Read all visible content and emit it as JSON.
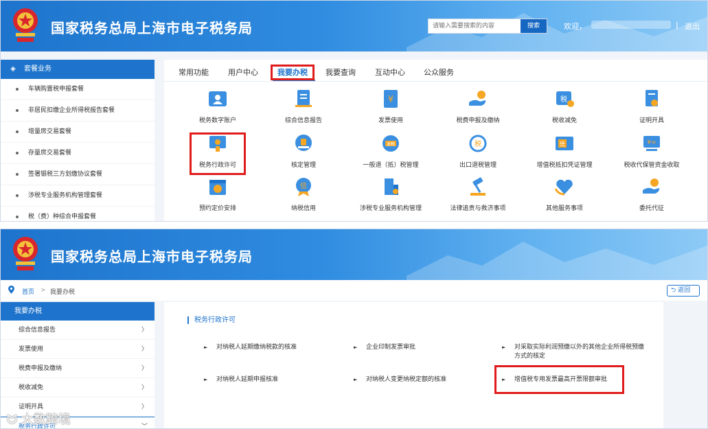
{
  "header": {
    "site_title": "国家税务总局上海市电子税务局",
    "search_placeholder": "请输入需要搜索的内容",
    "search_button": "搜索",
    "welcome": "欢迎，",
    "separator": "|",
    "logout": "退出"
  },
  "screen1": {
    "sidebar": {
      "title": "套餐业务",
      "items": [
        "车辆购置税申报套餐",
        "非居民扣缴企业所得税报告套餐",
        "增量房交易套餐",
        "存量房交易套餐",
        "签署银税三方划缴协议套餐",
        "涉税专业服务机构管理套餐",
        "税（费）种综合申报套餐"
      ]
    },
    "tabs": [
      "常用功能",
      "用户中心",
      "我要办税",
      "我要查询",
      "互动中心",
      "公众服务"
    ],
    "active_tab": "我要办税",
    "services": [
      {
        "label": "税务数字账户",
        "icon": "digital-account-icon"
      },
      {
        "label": "综合信息报告",
        "icon": "report-icon"
      },
      {
        "label": "发票使用",
        "icon": "invoice-icon"
      },
      {
        "label": "税费申报及缴纳",
        "icon": "declare-pay-icon"
      },
      {
        "label": "税收减免",
        "icon": "tax-reduction-icon"
      },
      {
        "label": "证明开具",
        "icon": "certificate-icon"
      },
      {
        "label": "税务行政许可",
        "icon": "admin-license-icon"
      },
      {
        "label": "核定管理",
        "icon": "assessment-icon"
      },
      {
        "label": "一般退（抵）税管理",
        "icon": "refund-icon"
      },
      {
        "label": "出口退税管理",
        "icon": "export-refund-icon"
      },
      {
        "label": "增值税抵扣凭证管理",
        "icon": "vat-voucher-icon"
      },
      {
        "label": "税收代保管资金收取",
        "icon": "custody-fund-icon"
      },
      {
        "label": "预约定价安排",
        "icon": "apa-calendar-icon"
      },
      {
        "label": "纳税信用",
        "icon": "credit-icon"
      },
      {
        "label": "涉税专业服务机构管理",
        "icon": "agency-icon"
      },
      {
        "label": "法律追责与救济事项",
        "icon": "law-gavel-icon"
      },
      {
        "label": "其他服务事项",
        "icon": "other-service-icon"
      },
      {
        "label": "委托代征",
        "icon": "entrust-icon"
      }
    ]
  },
  "screen2": {
    "breadcrumb": {
      "home": "首页",
      "current": "我要办税"
    },
    "back_button": "返回",
    "sidebar": {
      "title": "我要办税",
      "items": [
        "综合信息报告",
        "发票使用",
        "税费申报及缴纳",
        "税收减免",
        "证明开具",
        "税务行政许可"
      ]
    },
    "section_title": "税务行政许可",
    "licenses": [
      "对纳税人延期缴纳税款的核准",
      "企业印制发票审批",
      "对采取实际利润预缴以外的其他企业所得税预缴方式的核定",
      "对纳税人延期申报核准",
      "对纳税人变更纳税定额的核准",
      "增值税专用发票最高开票限额审批"
    ],
    "watermark": "大数跨境"
  },
  "colors": {
    "primary": "#1e74cc",
    "highlight": "#e01b1b",
    "icon_blue": "#3b8fe0",
    "icon_orange": "#f5a623"
  }
}
